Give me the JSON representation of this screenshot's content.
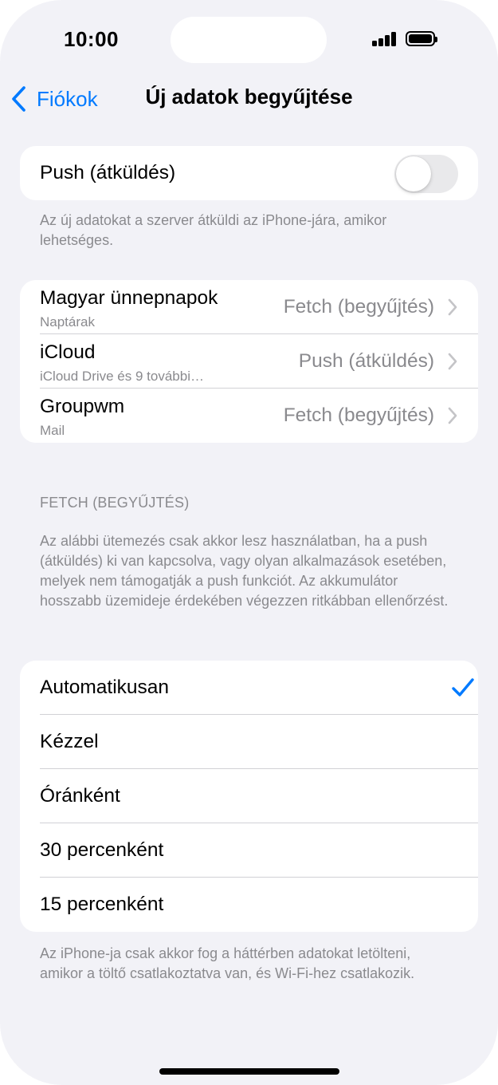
{
  "status_bar": {
    "time": "10:00"
  },
  "nav": {
    "back_label": "Fiókok",
    "title": "Új adatok begyűjtése"
  },
  "push": {
    "label": "Push (átküldés)",
    "enabled": false,
    "footer": "Az új adatokat a szerver átküldi az iPhone-jára, amikor lehetséges."
  },
  "accounts": [
    {
      "name": "Magyar ünnepnapok",
      "subtitle": "Naptárak",
      "value": "Fetch (begyűjtés)"
    },
    {
      "name": "iCloud",
      "subtitle": "iCloud Drive és 9 további…",
      "value": "Push (átküldés)"
    },
    {
      "name": "Groupwm",
      "subtitle": "Mail",
      "value": "Fetch (begyűjtés)"
    }
  ],
  "fetch": {
    "header": "FETCH (BEGYŰJTÉS)",
    "description": "Az alábbi ütemezés csak akkor lesz használatban, ha a push (átküldés) ki van kapcsolva, vagy olyan alkalmazások esetében, melyek nem támogatják a push funkciót. Az akkumulátor hosszabb üzemideje érdekében végezzen ritkábban ellenőrzést.",
    "options": [
      {
        "label": "Automatikusan",
        "selected": true
      },
      {
        "label": "Kézzel",
        "selected": false
      },
      {
        "label": "Óránként",
        "selected": false
      },
      {
        "label": "30 percenként",
        "selected": false
      },
      {
        "label": "15 percenként",
        "selected": false
      }
    ],
    "footer": "Az iPhone-ja csak akkor fog a háttérben adatokat letölteni, amikor a töltő csatlakoztatva van, és Wi-Fi-hez csatlakozik."
  },
  "colors": {
    "accent": "#007aff",
    "background": "#f2f2f7",
    "secondary_text": "#8a8a8e"
  }
}
